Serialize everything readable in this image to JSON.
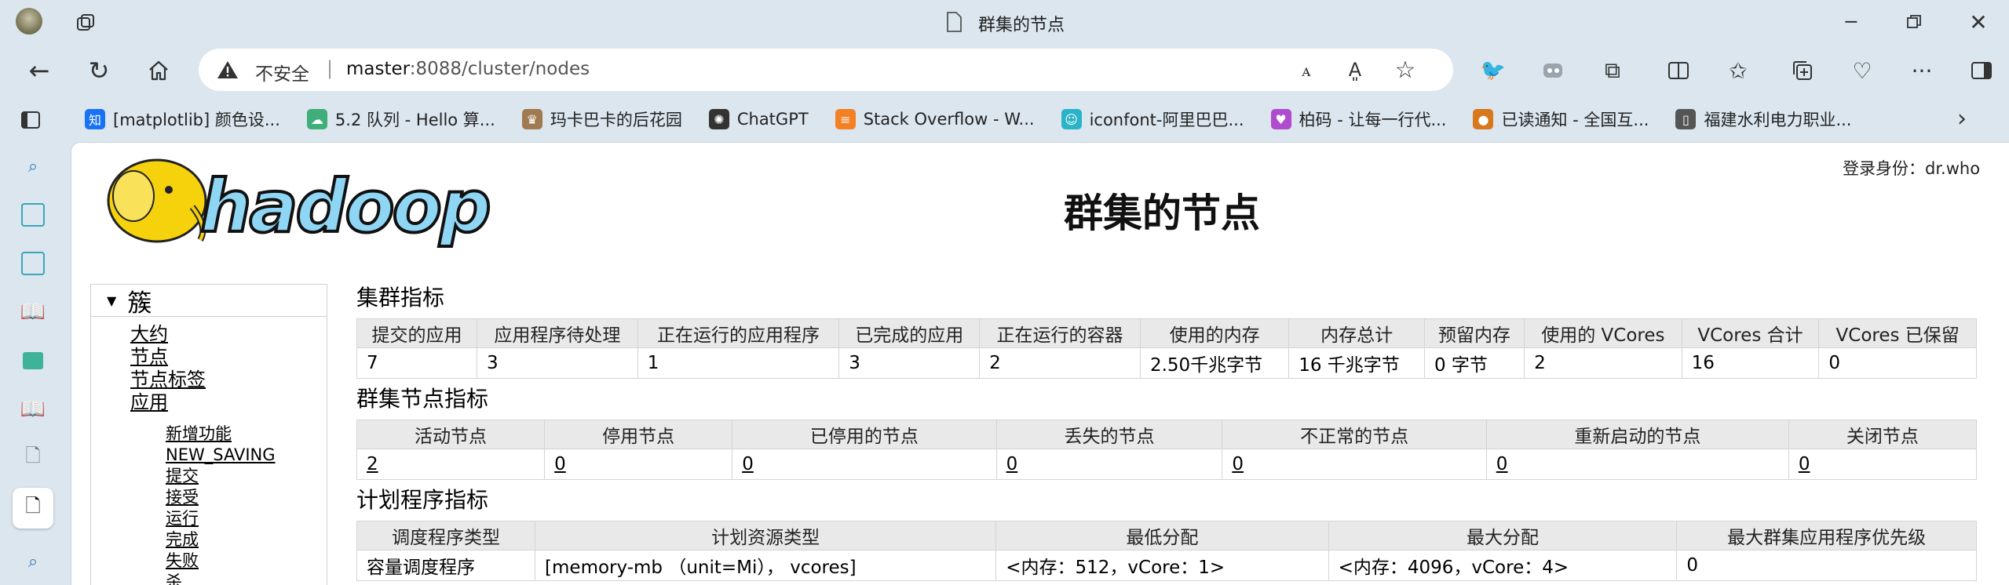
{
  "window": {
    "title": "群集的节点"
  },
  "address": {
    "security": "不安全",
    "separator": "|",
    "host": "master",
    "rest": ":8088/cluster/nodes"
  },
  "bookmarks": [
    {
      "label": "[matplotlib] 颜色设...",
      "icon": "知",
      "color": "#1772f6"
    },
    {
      "label": "5.2  队列 - Hello 算...",
      "icon": "☁",
      "color": "#3fae7a"
    },
    {
      "label": "玛卡巴卡的后花园",
      "icon": "♛",
      "color": "#a07a50"
    },
    {
      "label": "ChatGPT",
      "icon": "✺",
      "color": "#333333"
    },
    {
      "label": "Stack Overflow - W...",
      "icon": "≡",
      "color": "#f48024"
    },
    {
      "label": "iconfont-阿里巴巴...",
      "icon": "☺",
      "color": "#2bb3c8"
    },
    {
      "label": "柏码 - 让每一行代...",
      "icon": "♥",
      "color": "#b04ad0"
    },
    {
      "label": "已读通知 - 全国互...",
      "icon": "●",
      "color": "#d9771c"
    },
    {
      "label": "福建水利电力职业...",
      "icon": "▯",
      "color": "#555555"
    }
  ],
  "page": {
    "login": "登录身份：dr.who",
    "title": "群集的节点",
    "logo_text": "hadoop"
  },
  "nav": {
    "root": "簇",
    "items": [
      "大约",
      "节点",
      "节点标签",
      "应用"
    ],
    "sub": [
      "新增功能",
      "NEW_SAVING",
      "提交",
      "接受",
      "运行",
      "完成",
      "失败",
      "杀"
    ]
  },
  "cluster_metrics": {
    "title": "集群指标",
    "headers": [
      "提交的应用",
      "应用程序待处理",
      "正在运行的应用程序",
      "已完成的应用",
      "正在运行的容器",
      "使用的内存",
      "内存总计",
      "预留内存",
      "使用的 VCores",
      "VCores 合计",
      "VCores 已保留"
    ],
    "values": [
      "7",
      "3",
      "1",
      "3",
      "2",
      "2.50千兆字节",
      "16 千兆字节",
      "0 字节",
      "2",
      "16",
      "0"
    ]
  },
  "node_metrics": {
    "title": "群集节点指标",
    "headers": [
      "活动节点",
      "停用节点",
      "已停用的节点",
      "丢失的节点",
      "不正常的节点",
      "重新启动的节点",
      "关闭节点"
    ],
    "values": [
      "2",
      "0",
      "0",
      "0",
      "0",
      "0",
      "0"
    ]
  },
  "scheduler_metrics": {
    "title": "计划程序指标",
    "headers": [
      "调度程序类型",
      "计划资源类型",
      "最低分配",
      "最大分配",
      "最大群集应用程序优先级"
    ],
    "values": [
      "容量调度程序",
      "[memory-mb （unit=Mi）， vcores]",
      "<内存：512，vCore：1>",
      "<内存：4096，vCore：4>",
      "0"
    ]
  }
}
